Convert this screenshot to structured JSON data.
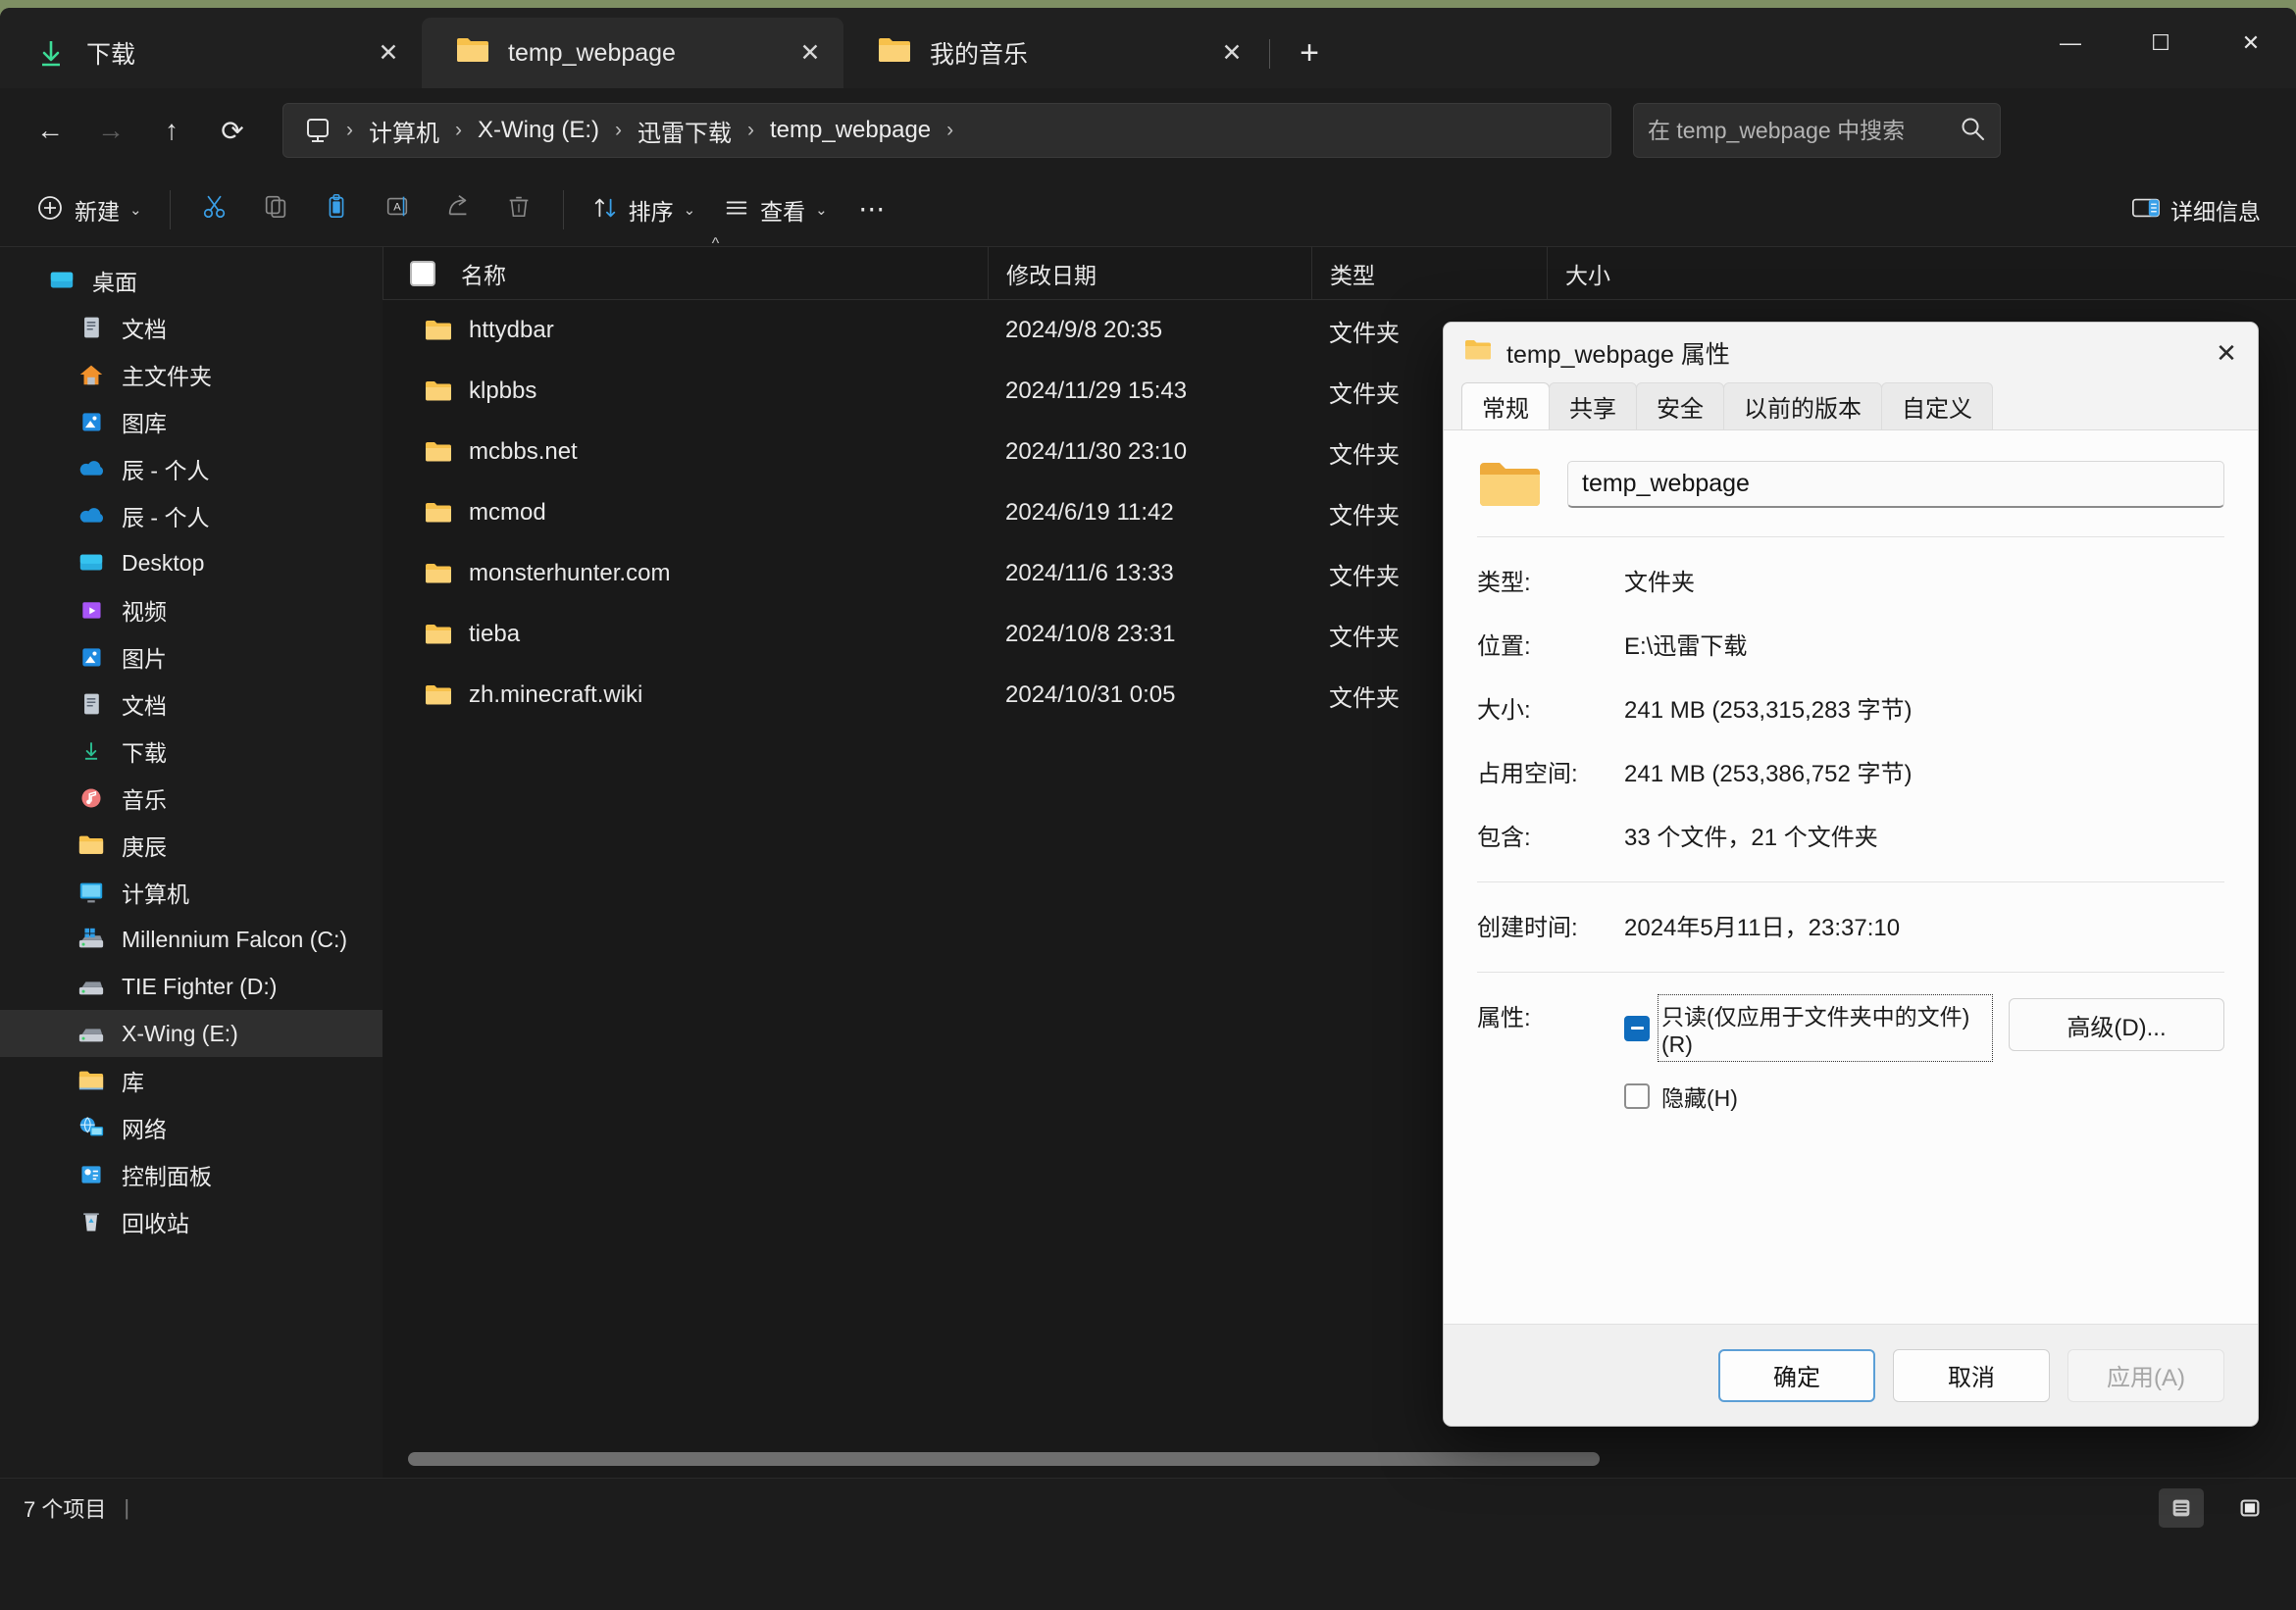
{
  "window": {
    "tabs": [
      {
        "label": "下载",
        "icon": "download-icon",
        "active": false
      },
      {
        "label": "temp_webpage",
        "icon": "folder-icon",
        "active": true
      },
      {
        "label": "我的音乐",
        "icon": "folder-icon",
        "active": false
      }
    ],
    "new_tab_label": "+",
    "controls": {
      "minimize": "—",
      "maximize": "☐",
      "close": "✕"
    }
  },
  "nav": {
    "back": "←",
    "forward": "→",
    "up": "↑",
    "refresh": "⟳",
    "breadcrumb": [
      "计算机",
      "X-Wing (E:)",
      "迅雷下载",
      "temp_webpage"
    ],
    "separator": "›"
  },
  "search": {
    "placeholder": "在 temp_webpage 中搜索",
    "value": "",
    "icon": "search-icon"
  },
  "toolbar": {
    "new_label": "新建",
    "new_chevron": "⌄",
    "cut_icon": "scissors-icon",
    "copy_icon": "copy-icon",
    "paste_icon": "clipboard-icon",
    "rename_icon": "rename-icon",
    "share_icon": "share-icon",
    "delete_icon": "trash-icon",
    "sort_label": "排序",
    "sort_icon": "sort-arrows-icon",
    "view_label": "查看",
    "view_icon": "list-lines-icon",
    "more_label": "⋯",
    "details_label": "详细信息",
    "details_icon": "details-pane-icon"
  },
  "sidebar": {
    "items": [
      {
        "label": "桌面",
        "icon": "desktop-icon",
        "indent": false,
        "selected": false
      },
      {
        "label": "文档",
        "icon": "documents-icon",
        "indent": true,
        "selected": false
      },
      {
        "label": "主文件夹",
        "icon": "home-icon",
        "indent": true,
        "selected": false
      },
      {
        "label": "图库",
        "icon": "gallery-icon",
        "indent": true,
        "selected": false
      },
      {
        "label": "辰 - 个人",
        "icon": "onedrive-icon",
        "indent": true,
        "selected": false
      },
      {
        "label": "辰 - 个人",
        "icon": "onedrive-icon",
        "indent": true,
        "selected": false
      },
      {
        "label": "Desktop",
        "icon": "desktop-icon",
        "indent": true,
        "selected": false
      },
      {
        "label": "视频",
        "icon": "videos-icon",
        "indent": true,
        "selected": false
      },
      {
        "label": "图片",
        "icon": "pictures-icon",
        "indent": true,
        "selected": false
      },
      {
        "label": "文档",
        "icon": "documents-icon",
        "indent": true,
        "selected": false
      },
      {
        "label": "下载",
        "icon": "download-icon",
        "indent": true,
        "selected": false
      },
      {
        "label": "音乐",
        "icon": "music-icon",
        "indent": true,
        "selected": false
      },
      {
        "label": "庚辰",
        "icon": "folder-icon",
        "indent": true,
        "selected": false
      },
      {
        "label": "计算机",
        "icon": "computer-icon",
        "indent": true,
        "selected": false
      },
      {
        "label": "Millennium Falcon (C:)",
        "icon": "windows-drive-icon",
        "indent": true,
        "selected": false
      },
      {
        "label": "TIE Fighter (D:)",
        "icon": "drive-icon",
        "indent": true,
        "selected": false
      },
      {
        "label": "X-Wing (E:)",
        "icon": "drive-icon",
        "indent": true,
        "selected": true
      },
      {
        "label": "库",
        "icon": "folder-icon",
        "indent": true,
        "selected": false
      },
      {
        "label": "网络",
        "icon": "network-icon",
        "indent": true,
        "selected": false
      },
      {
        "label": "控制面板",
        "icon": "control-panel-icon",
        "indent": true,
        "selected": false
      },
      {
        "label": "回收站",
        "icon": "recycle-bin-icon",
        "indent": true,
        "selected": false
      }
    ]
  },
  "filelist": {
    "columns": [
      "名称",
      "修改日期",
      "类型",
      "大小"
    ],
    "sort_indicator": "^",
    "rows": [
      {
        "name": "httydbar",
        "date": "2024/9/8 20:35",
        "type": "文件夹",
        "size": ""
      },
      {
        "name": "klpbbs",
        "date": "2024/11/29 15:43",
        "type": "文件夹",
        "size": ""
      },
      {
        "name": "mcbbs.net",
        "date": "2024/11/30 23:10",
        "type": "文件夹",
        "size": ""
      },
      {
        "name": "mcmod",
        "date": "2024/6/19 11:42",
        "type": "文件夹",
        "size": ""
      },
      {
        "name": "monsterhunter.com",
        "date": "2024/11/6 13:33",
        "type": "文件夹",
        "size": ""
      },
      {
        "name": "tieba",
        "date": "2024/10/8 23:31",
        "type": "文件夹",
        "size": ""
      },
      {
        "name": "zh.minecraft.wiki",
        "date": "2024/10/31 0:05",
        "type": "文件夹",
        "size": ""
      }
    ]
  },
  "statusbar": {
    "item_count": "7 个项目",
    "separator": "|",
    "details_view_icon": "details-view-icon",
    "large_icons_view_icon": "large-icons-view-icon"
  },
  "dialog": {
    "title": "temp_webpage 属性",
    "title_icon": "folder-icon",
    "close": "✕",
    "tabs": [
      {
        "label": "常规",
        "active": true
      },
      {
        "label": "共享",
        "active": false
      },
      {
        "label": "安全",
        "active": false
      },
      {
        "label": "以前的版本",
        "active": false
      },
      {
        "label": "自定义",
        "active": false
      }
    ],
    "folder_name_value": "temp_webpage",
    "properties": [
      {
        "label": "类型:",
        "value": "文件夹"
      },
      {
        "label": "位置:",
        "value": "E:\\迅雷下载"
      },
      {
        "label": "大小:",
        "value": "241 MB (253,315,283 字节)"
      },
      {
        "label": "占用空间:",
        "value": "241 MB (253,386,752 字节)"
      },
      {
        "label": "包含:",
        "value": "33 个文件，21 个文件夹"
      }
    ],
    "created": {
      "label": "创建时间:",
      "value": "2024年5月11日，23:37:10"
    },
    "attributes": {
      "label": "属性:",
      "readonly_text": "只读(仅应用于文件夹中的文件)(R)",
      "readonly_state": "indeterminate",
      "hidden_text": "隐藏(H)",
      "hidden_state": "unchecked",
      "advanced_label": "高级(D)..."
    },
    "buttons": {
      "ok": "确定",
      "cancel": "取消",
      "apply": "应用(A)"
    }
  },
  "colors": {
    "accent": "#0f6cbd",
    "window_bg": "#1c1c1c",
    "dialog_bg": "#f3f3f3",
    "folder_yellow": "#f7c14b",
    "selected_row": "#2f2f2f"
  }
}
